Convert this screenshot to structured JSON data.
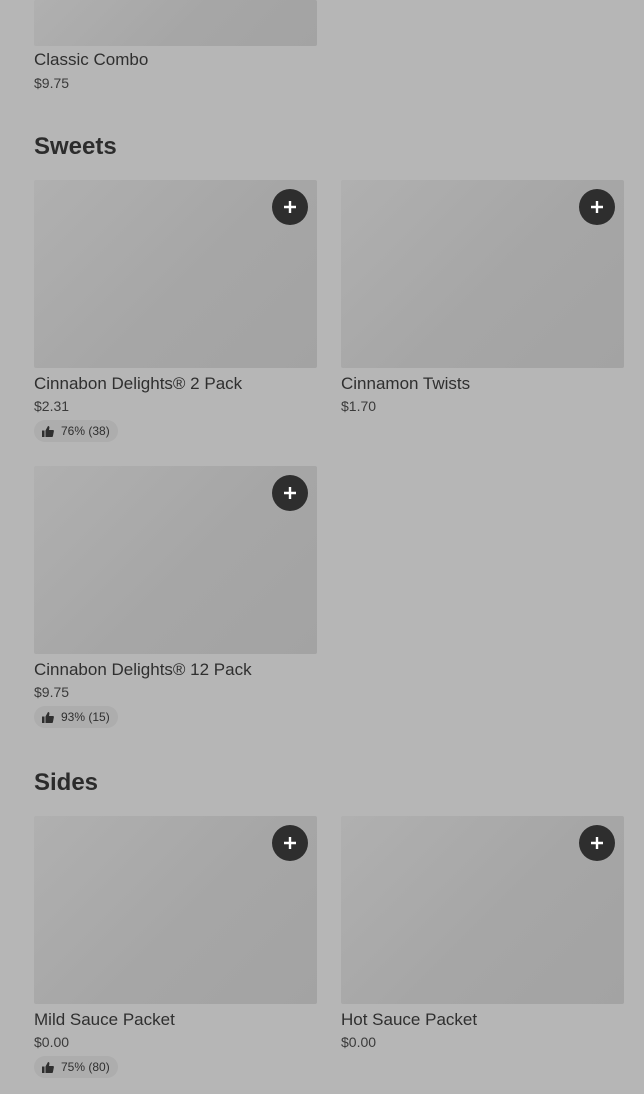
{
  "top_item": {
    "name": "Classic Combo",
    "price": "$9.75"
  },
  "sweets": {
    "title": "Sweets",
    "items": [
      {
        "name": "Cinnabon Delights® 2 Pack",
        "price": "$2.31",
        "rating": "76% (38)"
      },
      {
        "name": "Cinnamon Twists",
        "price": "$1.70"
      },
      {
        "name": "Cinnabon Delights® 12 Pack",
        "price": "$9.75",
        "rating": "93% (15)"
      }
    ]
  },
  "sides": {
    "title": "Sides",
    "items": [
      {
        "name": "Mild Sauce Packet",
        "price": "$0.00",
        "rating": "75% (80)"
      },
      {
        "name": "Hot Sauce Packet",
        "price": "$0.00"
      }
    ]
  },
  "icons": {
    "add": "plus-icon",
    "rating": "thumbs-up-icon"
  },
  "colors": {
    "background": "#b6b6b6",
    "button": "#2e2e2e",
    "badge": "#adadad"
  }
}
